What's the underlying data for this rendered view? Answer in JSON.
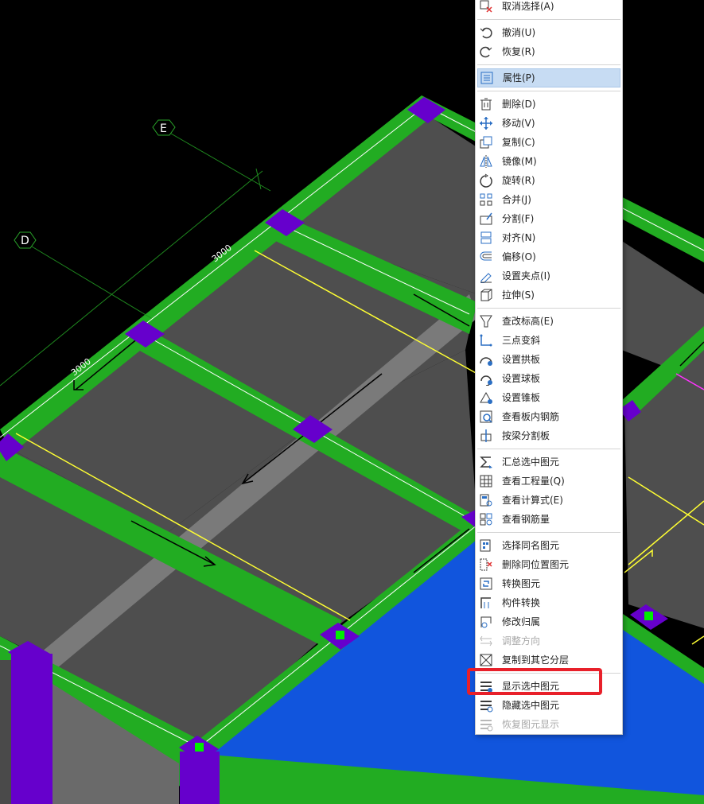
{
  "canvas": {
    "axis_labels": {
      "e": "E",
      "d": "D"
    },
    "dim_text_1": "3000",
    "dim_text_2": "3000",
    "colors": {
      "background": "#000000",
      "beam": "#22ac22",
      "slab": "#4e4e4e",
      "column": "#6600cc",
      "selected_slab": "#1155dd",
      "guide_line": "#ffff33",
      "grip": "#00ee00"
    }
  },
  "context_menu": {
    "items": [
      {
        "label": "取消选择(A)",
        "icon": "cancel-selection-icon",
        "enabled": true
      },
      {
        "separator": true
      },
      {
        "label": "撤消(U)",
        "icon": "undo-icon",
        "enabled": true
      },
      {
        "label": "恢复(R)",
        "icon": "redo-icon",
        "enabled": true
      },
      {
        "separator": true
      },
      {
        "label": "属性(P)",
        "icon": "properties-icon",
        "enabled": true,
        "selected": true
      },
      {
        "separator": true
      },
      {
        "label": "删除(D)",
        "icon": "delete-icon",
        "enabled": true
      },
      {
        "label": "移动(V)",
        "icon": "move-icon",
        "enabled": true
      },
      {
        "label": "复制(C)",
        "icon": "copy-icon",
        "enabled": true
      },
      {
        "label": "镜像(M)",
        "icon": "mirror-icon",
        "enabled": true
      },
      {
        "label": "旋转(R)",
        "icon": "rotate-icon",
        "enabled": true
      },
      {
        "label": "合并(J)",
        "icon": "merge-icon",
        "enabled": true
      },
      {
        "label": "分割(F)",
        "icon": "split-icon",
        "enabled": true
      },
      {
        "label": "对齐(N)",
        "icon": "align-icon",
        "enabled": true
      },
      {
        "label": "偏移(O)",
        "icon": "offset-icon",
        "enabled": true
      },
      {
        "label": "设置夹点(I)",
        "icon": "set-grip-icon",
        "enabled": true
      },
      {
        "label": "拉伸(S)",
        "icon": "stretch-icon",
        "enabled": true
      },
      {
        "separator": true
      },
      {
        "label": "查改标高(E)",
        "icon": "elevation-icon",
        "enabled": true
      },
      {
        "label": "三点变斜",
        "icon": "three-point-slope-icon",
        "enabled": true
      },
      {
        "label": "设置拱板",
        "icon": "arch-slab-icon",
        "enabled": true
      },
      {
        "label": "设置球板",
        "icon": "sphere-slab-icon",
        "enabled": true
      },
      {
        "label": "设置锥板",
        "icon": "cone-slab-icon",
        "enabled": true
      },
      {
        "label": "查看板内钢筋",
        "icon": "view-slab-rebar-icon",
        "enabled": true
      },
      {
        "label": "按梁分割板",
        "icon": "split-slab-by-beam-icon",
        "enabled": true
      },
      {
        "separator": true
      },
      {
        "label": "汇总选中图元",
        "icon": "sum-selected-icon",
        "enabled": true
      },
      {
        "label": "查看工程量(Q)",
        "icon": "view-quantity-icon",
        "enabled": true
      },
      {
        "label": "查看计算式(E)",
        "icon": "view-formula-icon",
        "enabled": true
      },
      {
        "label": "查看钢筋量",
        "icon": "view-rebar-quantity-icon",
        "enabled": true
      },
      {
        "separator": true
      },
      {
        "label": "选择同名图元",
        "icon": "select-same-name-icon",
        "enabled": true
      },
      {
        "label": "删除同位置图元",
        "icon": "delete-same-position-icon",
        "enabled": true
      },
      {
        "label": "转换图元",
        "icon": "convert-element-icon",
        "enabled": true
      },
      {
        "label": "构件转换",
        "icon": "component-convert-icon",
        "enabled": true
      },
      {
        "label": "修改归属",
        "icon": "modify-ownership-icon",
        "enabled": true
      },
      {
        "label": "调整方向",
        "icon": "adjust-direction-icon",
        "enabled": false
      },
      {
        "label": "复制到其它分层",
        "icon": "copy-to-layer-icon",
        "enabled": true
      },
      {
        "separator": true
      },
      {
        "label": "显示选中图元",
        "icon": "show-selected-icon",
        "enabled": true,
        "red_box": true
      },
      {
        "label": "隐藏选中图元",
        "icon": "hide-selected-icon",
        "enabled": true
      },
      {
        "label": "恢复图元显示",
        "icon": "restore-display-icon",
        "enabled": false
      }
    ]
  }
}
